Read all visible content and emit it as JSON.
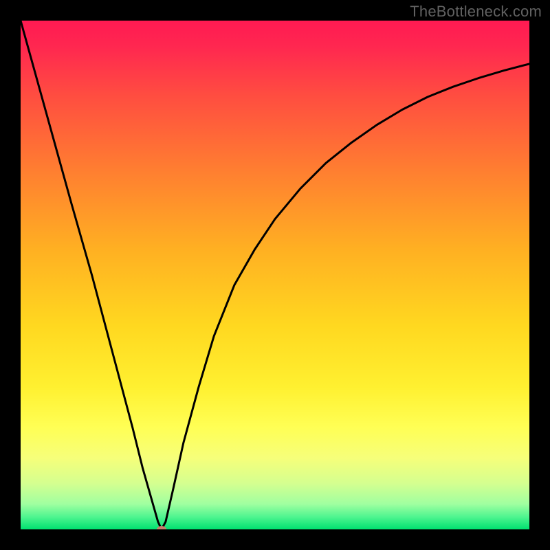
{
  "watermark": "TheBottleneck.com",
  "chart_data": {
    "type": "line",
    "title": "",
    "xlabel": "",
    "ylabel": "",
    "xlim": [
      0,
      100
    ],
    "ylim": [
      0,
      100
    ],
    "background_gradient": {
      "stops": [
        {
          "pos": 0.0,
          "color": "#ff1a52"
        },
        {
          "pos": 0.05,
          "color": "#ff2750"
        },
        {
          "pos": 0.15,
          "color": "#ff4e40"
        },
        {
          "pos": 0.3,
          "color": "#ff8030"
        },
        {
          "pos": 0.45,
          "color": "#ffb022"
        },
        {
          "pos": 0.6,
          "color": "#ffd820"
        },
        {
          "pos": 0.72,
          "color": "#fff030"
        },
        {
          "pos": 0.8,
          "color": "#ffff55"
        },
        {
          "pos": 0.86,
          "color": "#f6ff7a"
        },
        {
          "pos": 0.91,
          "color": "#d4ff90"
        },
        {
          "pos": 0.95,
          "color": "#a0ffa0"
        },
        {
          "pos": 0.975,
          "color": "#50f590"
        },
        {
          "pos": 1.0,
          "color": "#00e070"
        }
      ]
    },
    "series": [
      {
        "name": "curve",
        "x": [
          0,
          5,
          10,
          14,
          18,
          22,
          24,
          26,
          27,
          27.7,
          28.5,
          30,
          32,
          35,
          38,
          42,
          46,
          50,
          55,
          60,
          65,
          70,
          75,
          80,
          85,
          90,
          95,
          100
        ],
        "y": [
          100,
          82,
          64,
          50,
          35,
          20,
          12,
          5,
          1.5,
          0.0,
          1.5,
          8,
          17,
          28,
          38,
          48,
          55,
          61,
          67,
          72,
          76,
          79.5,
          82.5,
          85,
          87,
          88.7,
          90.2,
          91.5
        ],
        "color": "#000000",
        "width": 3
      }
    ],
    "minimum_marker": {
      "x": 27.7,
      "y": 0.0,
      "color": "#c77d6c"
    }
  }
}
